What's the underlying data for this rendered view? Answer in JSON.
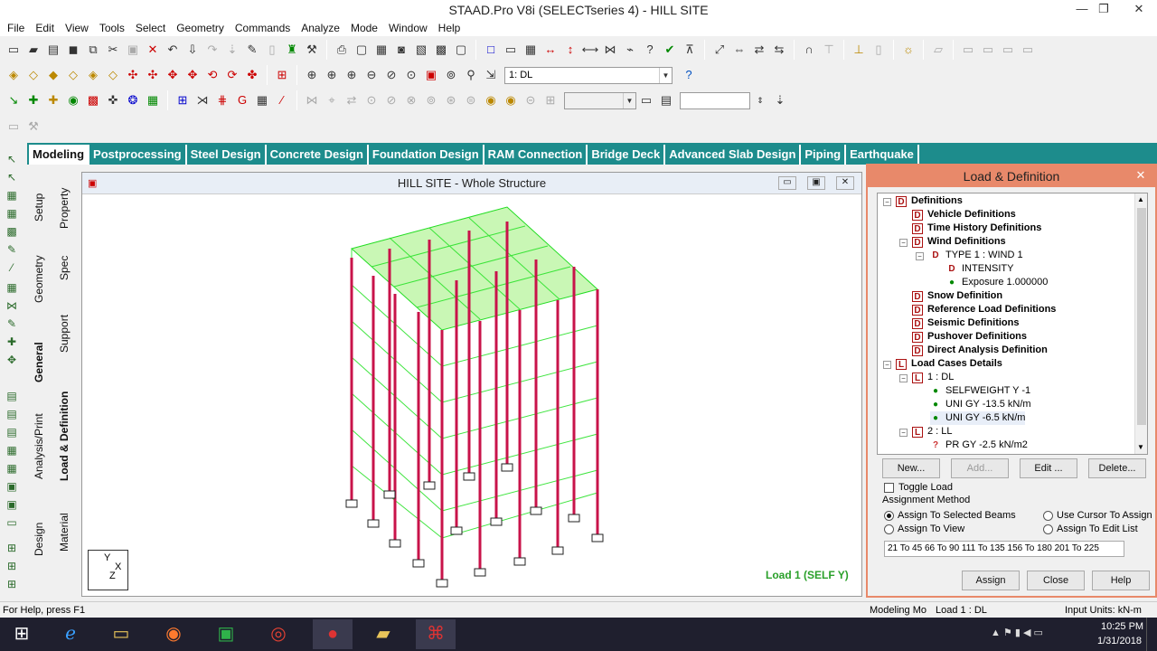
{
  "window": {
    "title": "STAAD.Pro V8i (SELECTseries 4) - HILL SITE",
    "minimize": "—",
    "restore": "❐",
    "close": "✕"
  },
  "menu": [
    "File",
    "Edit",
    "View",
    "Tools",
    "Select",
    "Geometry",
    "Commands",
    "Analyze",
    "Mode",
    "Window",
    "Help"
  ],
  "toolbar": {
    "load_case_value": "1: DL",
    "unit_field": ""
  },
  "tabs": [
    "Modeling",
    "Postprocessing",
    "Steel Design",
    "Concrete Design",
    "Foundation Design",
    "RAM Connection",
    "Bridge Deck",
    "Advanced Slab Design",
    "Piping",
    "Earthquake"
  ],
  "side_tabs": {
    "col1": [
      "Setup",
      "Geometry",
      "General",
      "Analysis/Print",
      "Design"
    ],
    "col2": [
      "Property",
      "Spec",
      "Support",
      "Load & Definition",
      "Material"
    ]
  },
  "viewport": {
    "title": "HILL SITE - Whole Structure",
    "load_label": "Load 1 (SELF Y)",
    "axis_y": "Y",
    "axis_x": "X",
    "axis_z": "Z"
  },
  "dialog": {
    "title": "Load & Definition",
    "close_icon": "✕",
    "tree": [
      {
        "label": "Definitions",
        "icon": "D",
        "bold": true
      },
      {
        "label": "Vehicle Definitions",
        "icon": "D",
        "bold": true
      },
      {
        "label": "Time History Definitions",
        "icon": "D",
        "bold": true
      },
      {
        "label": "Wind Definitions",
        "icon": "D",
        "bold": true
      },
      {
        "label": "TYPE 1 : WIND 1",
        "icon": "D",
        "bold": false
      },
      {
        "label": "INTENSITY",
        "icon": "D",
        "bold": false
      },
      {
        "label": "Exposure 1.000000",
        "icon": "g",
        "bold": false
      },
      {
        "label": "Snow Definition",
        "icon": "D",
        "bold": true
      },
      {
        "label": "Reference Load Definitions",
        "icon": "D",
        "bold": true
      },
      {
        "label": "Seismic Definitions",
        "icon": "D",
        "bold": true
      },
      {
        "label": "Pushover Definitions",
        "icon": "D",
        "bold": true
      },
      {
        "label": "Direct Analysis Definition",
        "icon": "D",
        "bold": true
      },
      {
        "label": "Load Cases Details",
        "icon": "L",
        "bold": true
      },
      {
        "label": "1 : DL",
        "icon": "L",
        "bold": false
      },
      {
        "label": "SELFWEIGHT Y -1",
        "icon": "g",
        "bold": false
      },
      {
        "label": "UNI GY -13.5 kN/m",
        "icon": "g",
        "bold": false
      },
      {
        "label": "UNI GY -6.5 kN/m",
        "icon": "g",
        "bold": false
      },
      {
        "label": "2 : LL",
        "icon": "L",
        "bold": false
      },
      {
        "label": "PR GY -2.5 kN/m2",
        "icon": "q",
        "bold": false
      }
    ],
    "buttons": {
      "new": "New...",
      "add": "Add...",
      "edit": "Edit ...",
      "delete": "Delete..."
    },
    "toggle_load": "Toggle Load",
    "assignment_method": "Assignment Method",
    "radios": {
      "selected_beams": "Assign To Selected Beams",
      "cursor": "Use Cursor To Assign",
      "view": "Assign To View",
      "edit_list": "Assign To Edit List"
    },
    "assign_list": "21 To 45 66 To 90 111 To 135 156 To 180 201 To 225",
    "assign": "Assign",
    "close": "Close",
    "help": "Help"
  },
  "status": {
    "help": "For Help, press F1",
    "mode": "Modeling Mo",
    "load": "Load 1 : DL",
    "units": "Input Units:  kN-m"
  },
  "taskbar": {
    "time": "10:25 PM",
    "date": "1/31/2018"
  }
}
